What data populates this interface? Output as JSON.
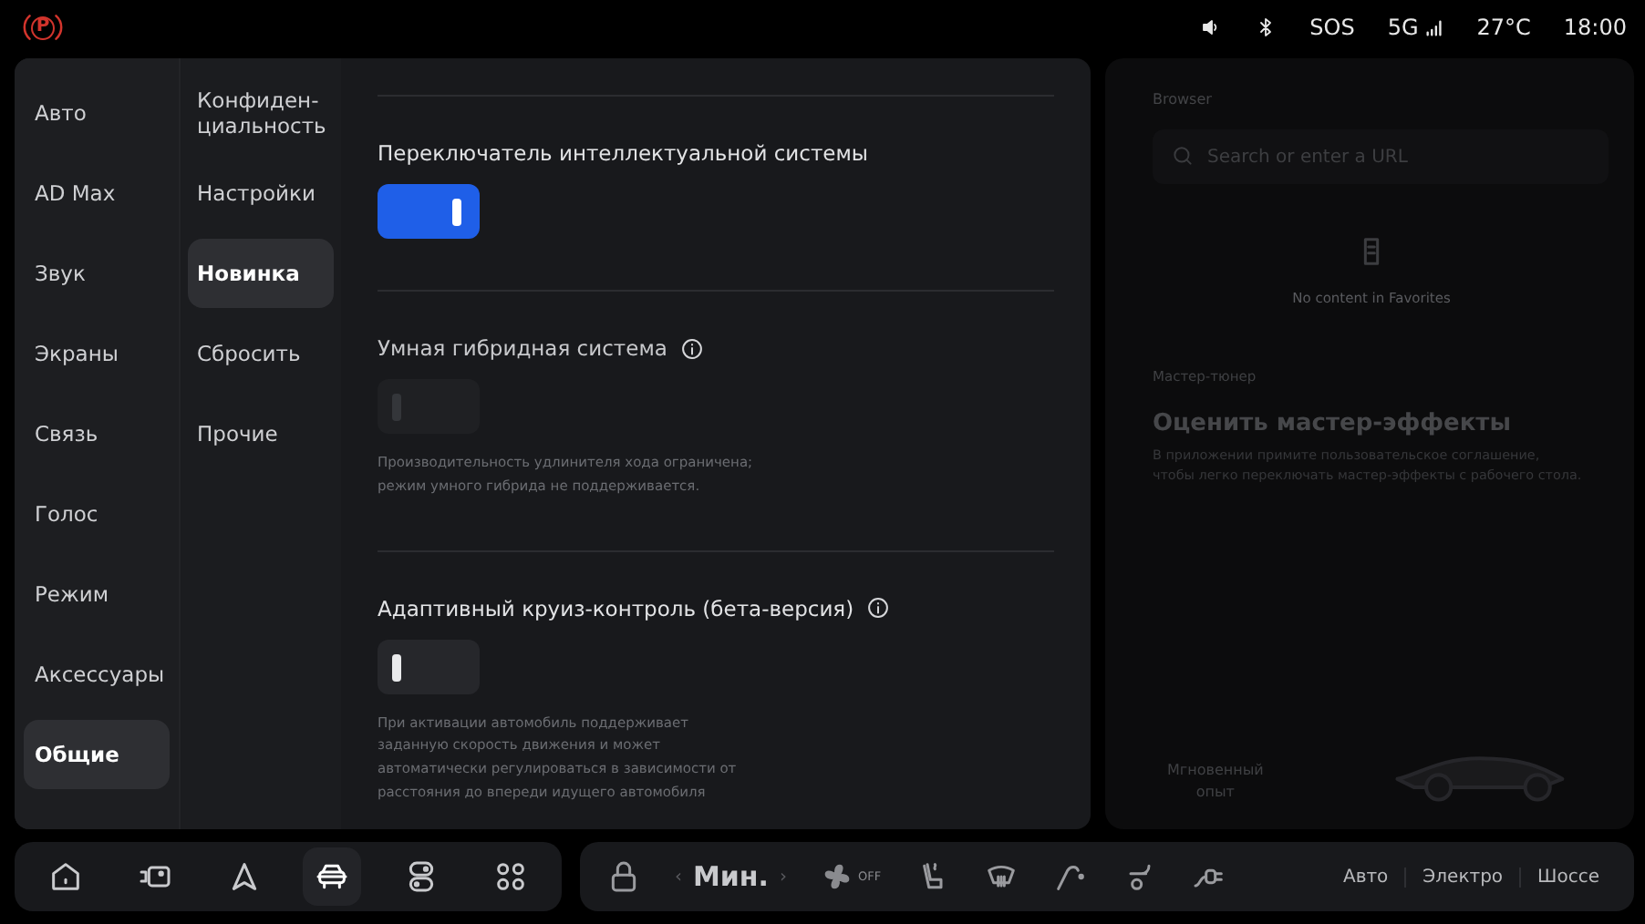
{
  "status_bar": {
    "parking_letter": "P",
    "sos": "SOS",
    "network": "5G",
    "temperature": "27°C",
    "time": "18:00"
  },
  "nav": {
    "items": [
      {
        "label": "Авто",
        "selected": false
      },
      {
        "label": "AD Max",
        "selected": false
      },
      {
        "label": "Звук",
        "selected": false
      },
      {
        "label": "Экраны",
        "selected": false
      },
      {
        "label": "Связь",
        "selected": false
      },
      {
        "label": "Голос",
        "selected": false
      },
      {
        "label": "Режим",
        "selected": false
      },
      {
        "label": "Аксессуары",
        "selected": false
      },
      {
        "label": "Общие",
        "selected": true
      }
    ]
  },
  "subnav": {
    "items": [
      {
        "label": "Конфиден-\nциальность",
        "selected": false
      },
      {
        "label": "Настройки",
        "selected": false
      },
      {
        "label": "Новинка",
        "selected": true
      },
      {
        "label": "Сбросить",
        "selected": false
      },
      {
        "label": "Прочие",
        "selected": false
      }
    ]
  },
  "settings": [
    {
      "title": "Переключатель интеллектуальной системы",
      "info": false,
      "on": true,
      "disabled": false
    },
    {
      "title": "Умная гибридная система",
      "info": true,
      "on": false,
      "disabled": true,
      "note": "Производительность удлинителя хода ограничена;\nрежим умного гибрида не поддерживается."
    },
    {
      "title": "Адаптивный круиз-контроль (бета-версия)",
      "info": true,
      "on": false,
      "disabled": false,
      "note": "При активации автомобиль поддерживает\nзаданную скорость движения и может\nавтоматически регулироваться в зависимости от\nрасстояния до впереди идущего автомобиля"
    }
  ],
  "browser": {
    "title": "Browser",
    "search": {
      "placeholder": "Search or enter a URL"
    },
    "empty_text": "No content in Favorites"
  },
  "tuner": {
    "label": "Мастер-тюнер",
    "title": "Оценить мастер-эффекты",
    "description": "В приложении примите пользовательское соглашение,\nчтобы легко переключать мастер-эффекты с рабочего стола.",
    "action": "Мгновенный\nопыт"
  },
  "dock": {
    "apps": [
      {
        "kind": "home",
        "selected": false
      },
      {
        "kind": "camera",
        "selected": false
      },
      {
        "kind": "navigation",
        "selected": false
      },
      {
        "kind": "car",
        "selected": true
      },
      {
        "kind": "switches",
        "selected": false
      },
      {
        "kind": "apps",
        "selected": false
      }
    ],
    "fan_prev": "‹",
    "fan_level": "Мин.",
    "fan_next": "›",
    "fan_state": "OFF",
    "modes": [
      {
        "label": "Авто"
      },
      {
        "label": "Электро"
      },
      {
        "label": "Шоссе"
      }
    ]
  }
}
